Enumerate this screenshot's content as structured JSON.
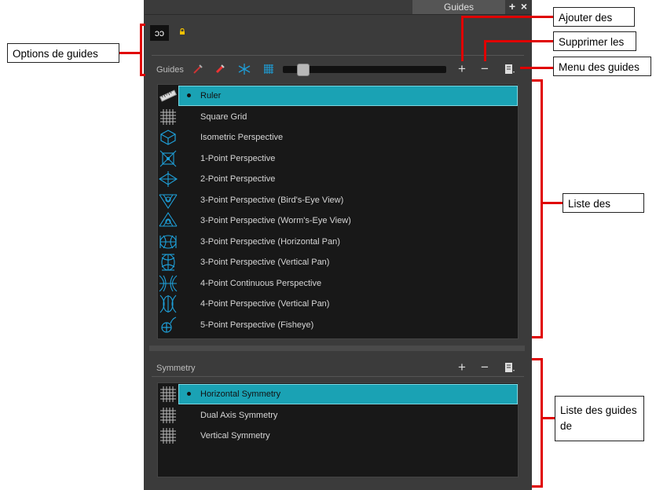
{
  "panel": {
    "tab_title": "Guides",
    "options_button_label": "ɔɔ",
    "guides_label": "Guides",
    "symmetry_label": "Symmetry",
    "add_symbol": "+",
    "remove_symbol": "−"
  },
  "guides_list": [
    {
      "label": "Ruler",
      "icon": "ruler-icon",
      "selected": true
    },
    {
      "label": "Square Grid",
      "icon": "grid-icon"
    },
    {
      "label": "Isometric Perspective",
      "icon": "cube-icon"
    },
    {
      "label": "1-Point Perspective",
      "icon": "one-point-icon"
    },
    {
      "label": "2-Point Perspective",
      "icon": "two-point-icon"
    },
    {
      "label": "3-Point Perspective (Bird's-Eye View)",
      "icon": "three-point-bird-icon"
    },
    {
      "label": "3-Point Perspective (Worm's-Eye View)",
      "icon": "three-point-worm-icon"
    },
    {
      "label": "3-Point Perspective (Horizontal Pan)",
      "icon": "three-point-hpan-icon"
    },
    {
      "label": "3-Point Perspective (Vertical Pan)",
      "icon": "three-point-vpan-icon"
    },
    {
      "label": "4-Point Continuous Perspective",
      "icon": "four-point-continuous-icon"
    },
    {
      "label": "4-Point Perspective (Vertical Pan)",
      "icon": "four-point-vpan-icon"
    },
    {
      "label": "5-Point Perspective (Fisheye)",
      "icon": "fisheye-icon"
    }
  ],
  "symmetry_list": [
    {
      "label": "Horizontal Symmetry",
      "icon": "grid-icon",
      "selected": true
    },
    {
      "label": "Dual Axis Symmetry",
      "icon": "grid-icon"
    },
    {
      "label": "Vertical Symmetry",
      "icon": "grid-icon"
    }
  ],
  "callouts": {
    "options": "Options de guides",
    "add": "Ajouter des",
    "remove": "Supprimer les",
    "menu": "Menu des guides",
    "list": "Liste des",
    "symmetry_list": "Liste des guides de"
  },
  "colors": {
    "accent": "#1aa2b4",
    "icon_blue": "#1e9fd8",
    "callout_line": "#e00000"
  }
}
